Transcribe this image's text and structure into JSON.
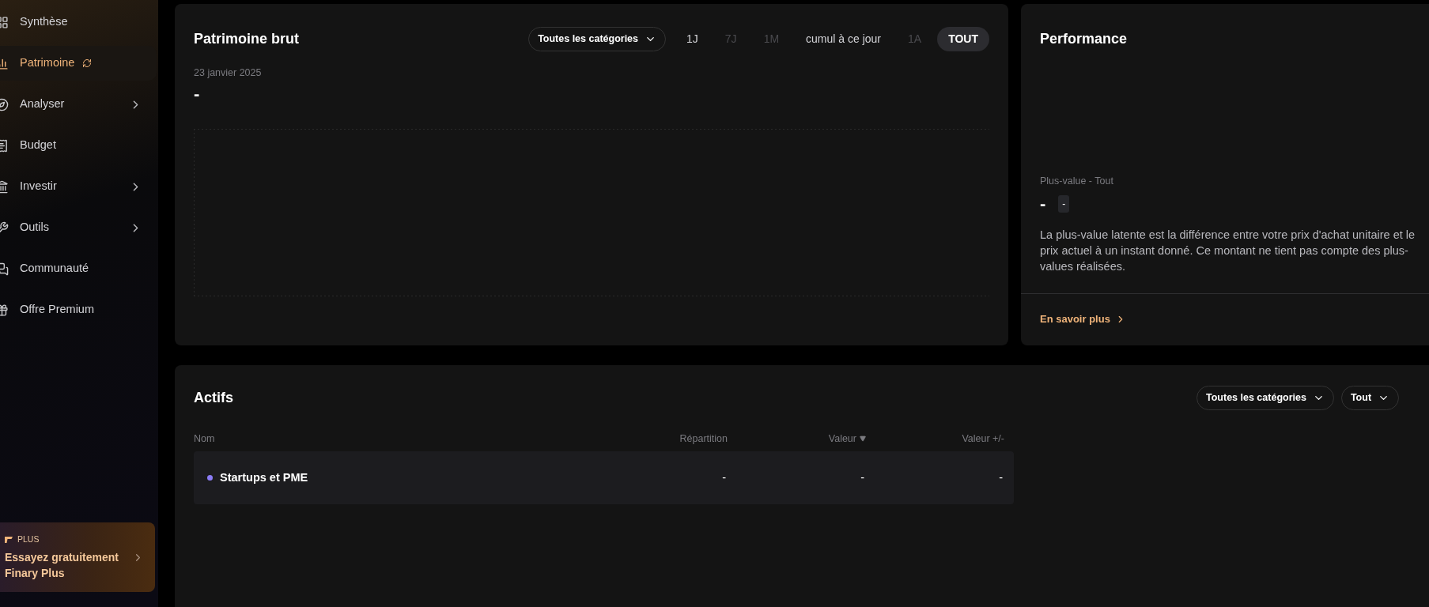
{
  "sidebar": {
    "items": [
      {
        "label": "Synthèse",
        "selected": false,
        "has_submenu": false,
        "refreshing": false
      },
      {
        "label": "Patrimoine",
        "selected": true,
        "has_submenu": false,
        "refreshing": true
      },
      {
        "label": "Analyser",
        "selected": false,
        "has_submenu": true,
        "refreshing": false
      },
      {
        "label": "Budget",
        "selected": false,
        "has_submenu": false,
        "refreshing": false
      },
      {
        "label": "Investir",
        "selected": false,
        "has_submenu": true,
        "refreshing": false
      },
      {
        "label": "Outils",
        "selected": false,
        "has_submenu": true,
        "refreshing": false
      },
      {
        "label": "Communauté",
        "selected": false,
        "has_submenu": false,
        "refreshing": false
      },
      {
        "label": "Offre Premium",
        "selected": false,
        "has_submenu": false,
        "refreshing": false
      }
    ],
    "promo": {
      "badge": "PLUS",
      "title": "Essayez gratuitement Finary Plus"
    }
  },
  "net_worth": {
    "title": "Patrimoine brut",
    "category_filter": "Toutes les catégories",
    "periods": [
      {
        "label": "1J",
        "selected": false,
        "disabled": false
      },
      {
        "label": "7J",
        "selected": false,
        "disabled": true
      },
      {
        "label": "1M",
        "selected": false,
        "disabled": true
      },
      {
        "label": "cumul à ce jour",
        "selected": false,
        "disabled": false
      },
      {
        "label": "1A",
        "selected": false,
        "disabled": true
      },
      {
        "label": "TOUT",
        "selected": true,
        "disabled": false
      }
    ],
    "date": "23 janvier 2025",
    "value": "-"
  },
  "performance": {
    "title": "Performance",
    "label": "Plus-value - Tout",
    "value": "-",
    "change": "-",
    "description": "La plus-value latente est la différence entre votre prix d'achat unitaire et le prix actuel à un instant donné. Ce montant ne tient pas compte des plus-values réalisées.",
    "link": "En savoir plus"
  },
  "assets": {
    "title": "Actifs",
    "filters": [
      "Toutes les catégories",
      "Tout"
    ],
    "columns": [
      {
        "label": "Nom",
        "sorted": false
      },
      {
        "label": "Répartition",
        "sorted": false
      },
      {
        "label": "Valeur",
        "sorted": true
      },
      {
        "label": "Valeur +/-",
        "sorted": false
      }
    ],
    "rows": [
      {
        "name": "Startups et PME",
        "color": "#8b7cf6",
        "share": "-",
        "value": "-",
        "change": "-"
      }
    ]
  }
}
